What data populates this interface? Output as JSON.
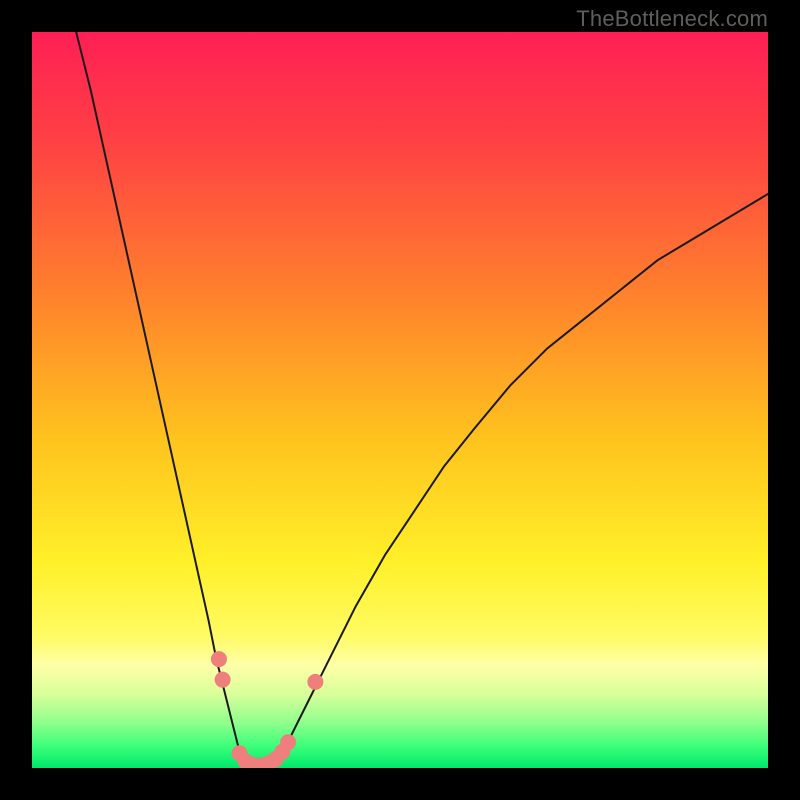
{
  "watermark": "TheBottleneck.com",
  "chart_data": {
    "type": "line",
    "title": "",
    "xlabel": "",
    "ylabel": "",
    "xlim": [
      0,
      100
    ],
    "ylim": [
      0,
      100
    ],
    "legend": false,
    "grid": false,
    "annotations": [],
    "background_gradient": {
      "stops": [
        {
          "pos": 0.0,
          "color": "#ff1f55"
        },
        {
          "pos": 0.15,
          "color": "#ff4144"
        },
        {
          "pos": 0.35,
          "color": "#ff7f2d"
        },
        {
          "pos": 0.55,
          "color": "#ffc21e"
        },
        {
          "pos": 0.72,
          "color": "#fff029"
        },
        {
          "pos": 0.82,
          "color": "#fffb63"
        },
        {
          "pos": 0.86,
          "color": "#ffffa8"
        },
        {
          "pos": 0.9,
          "color": "#d8ff9a"
        },
        {
          "pos": 0.94,
          "color": "#8cff8c"
        },
        {
          "pos": 0.97,
          "color": "#3dff7a"
        },
        {
          "pos": 1.0,
          "color": "#00e86b"
        }
      ]
    },
    "series": [
      {
        "name": "curve-left",
        "color": "#1a1a1a",
        "x": [
          6,
          8,
          10,
          12,
          14,
          16,
          18,
          20,
          22,
          24,
          25,
          26,
          27,
          28,
          28.5
        ],
        "y": [
          100,
          92,
          83,
          74,
          65,
          56,
          47,
          38,
          29,
          20,
          15,
          11,
          7,
          3,
          1
        ]
      },
      {
        "name": "curve-right",
        "color": "#1a1a1a",
        "x": [
          33.5,
          35,
          37,
          40,
          44,
          48,
          52,
          56,
          60,
          65,
          70,
          75,
          80,
          85,
          90,
          95,
          100
        ],
        "y": [
          1,
          4,
          8,
          14,
          22,
          29,
          35,
          41,
          46,
          52,
          57,
          61,
          65,
          69,
          72,
          75,
          78
        ]
      },
      {
        "name": "valley-floor",
        "color": "#1a1a1a",
        "x": [
          28.5,
          29.5,
          31,
          32.5,
          33.5
        ],
        "y": [
          1,
          0.4,
          0.2,
          0.4,
          1
        ]
      }
    ],
    "markers": [
      {
        "name": "threshold-dot",
        "x": 25.4,
        "y": 14.8,
        "r": 8,
        "color": "#ee7f7c"
      },
      {
        "name": "threshold-dot",
        "x": 25.9,
        "y": 12.0,
        "r": 8,
        "color": "#ee7f7c"
      },
      {
        "name": "threshold-dot",
        "x": 28.2,
        "y": 2.0,
        "r": 8,
        "color": "#ee7f7c"
      },
      {
        "name": "threshold-dot",
        "x": 29.0,
        "y": 0.9,
        "r": 8,
        "color": "#ee7f7c"
      },
      {
        "name": "threshold-dot",
        "x": 29.8,
        "y": 0.5,
        "r": 8,
        "color": "#ee7f7c"
      },
      {
        "name": "threshold-dot",
        "x": 30.6,
        "y": 0.3,
        "r": 8,
        "color": "#ee7f7c"
      },
      {
        "name": "threshold-dot",
        "x": 31.5,
        "y": 0.4,
        "r": 8,
        "color": "#ee7f7c"
      },
      {
        "name": "threshold-dot",
        "x": 32.3,
        "y": 0.7,
        "r": 8,
        "color": "#ee7f7c"
      },
      {
        "name": "threshold-dot",
        "x": 33.1,
        "y": 1.2,
        "r": 8,
        "color": "#ee7f7c"
      },
      {
        "name": "threshold-dot",
        "x": 34.0,
        "y": 2.2,
        "r": 8,
        "color": "#ee7f7c"
      },
      {
        "name": "threshold-dot",
        "x": 34.8,
        "y": 3.5,
        "r": 8,
        "color": "#ee7f7c"
      },
      {
        "name": "threshold-dot",
        "x": 38.5,
        "y": 11.7,
        "r": 8,
        "color": "#ee7f7c"
      }
    ]
  }
}
